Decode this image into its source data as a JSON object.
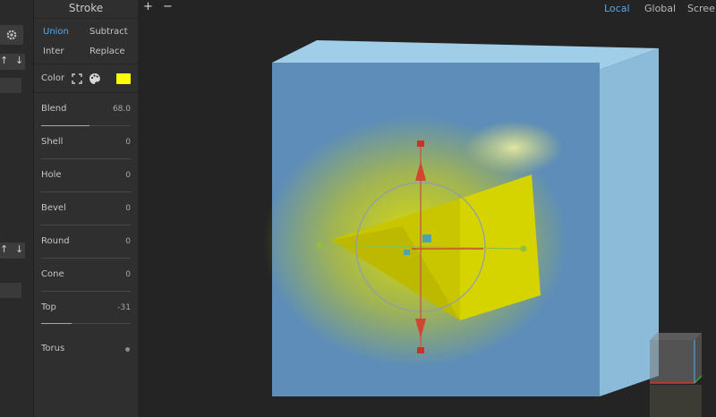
{
  "panel": {
    "title": "Stroke",
    "ops": {
      "union": "Union",
      "subtract": "Subtract",
      "inter": "Inter",
      "replace": "Replace"
    },
    "color_label": "Color",
    "color_value": "#ffff00",
    "blend": {
      "label": "Blend",
      "value": "68.0",
      "level": 0.54
    },
    "shell": {
      "label": "Shell",
      "value": "0"
    },
    "hole": {
      "label": "Hole",
      "value": "0"
    },
    "bevel": {
      "label": "Bevel",
      "value": "0"
    },
    "round": {
      "label": "Round",
      "value": "0"
    },
    "cone": {
      "label": "Cone",
      "value": "0"
    },
    "top": {
      "label": "Top",
      "value": "-31",
      "level": 0.34
    },
    "torus": {
      "label": "Torus"
    }
  },
  "toolbar": {
    "plus": "+",
    "minus": "−"
  },
  "view_modes": {
    "local": "Local",
    "global": "Global",
    "screen": "Scree"
  },
  "left_strip": {
    "up": "↑",
    "down": "↓"
  },
  "colors": {
    "accent": "#5aa7e6",
    "cube_face": "#5d8db8",
    "cube_side": "#8bbbd8",
    "cube_top": "#9dcbe6",
    "shape": "#d4d400"
  }
}
